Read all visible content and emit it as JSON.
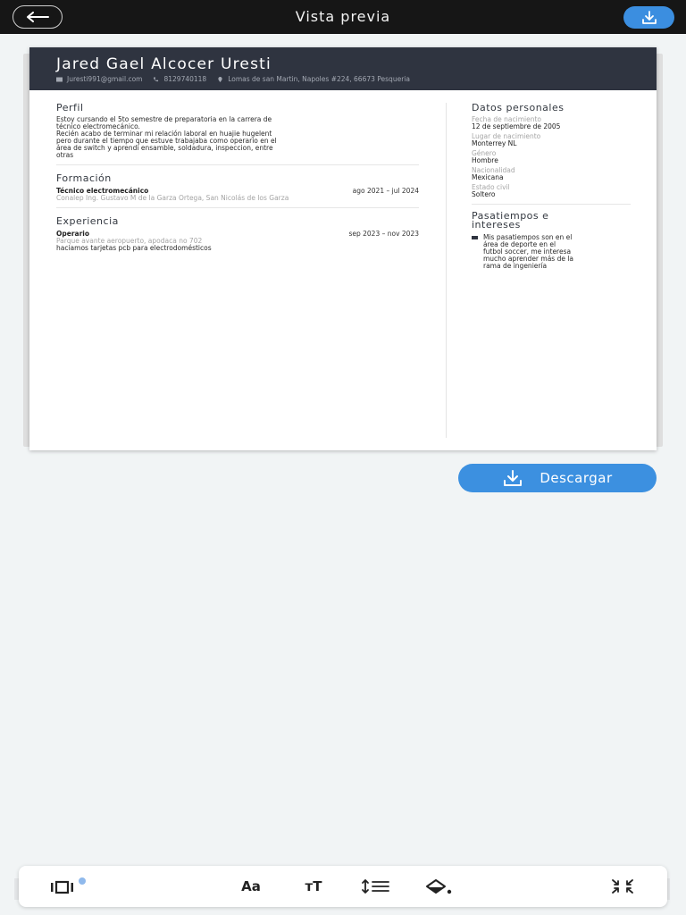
{
  "topbar": {
    "title": "Vista previa"
  },
  "resume": {
    "name": "Jared Gael Alcocer Uresti",
    "contact": {
      "email": "Juresti991@gmail.com",
      "phone": "8129740118",
      "address": "Lomas de san Martin, Napoles #224, 66673 Pesqueria"
    },
    "profile": {
      "title": "Perfil",
      "lines": [
        "Estoy cursando el 5to semestre de preparatoria en la carrera de",
        "técnico electromecánico.",
        "Recién acabo de terminar mi relación laboral en huajie hugelent",
        "pero durante el tiempo que estuve trabajaba como operario en el",
        "área de switch y aprendí ensamble, soldadura, inspeccion, entre",
        "otras"
      ]
    },
    "education": {
      "title": "Formación",
      "degree": "Técnico electromecánico",
      "dates": "ago 2021 – jul 2024",
      "school": "Conalep Ing. Gustavo M de la Garza Ortega, San Nicolás de los Garza"
    },
    "experience": {
      "title": "Experiencia",
      "role": "Operario",
      "dates": "sep 2023 – nov 2023",
      "company": "Parque avante aeropuerto, apodaca no 702",
      "description": "haciamos tarjetas pcb para electrodomésticos"
    },
    "personal": {
      "title": "Datos personales",
      "birth_date_label": "Fecha de nacimiento",
      "birth_date": "12 de septiembre de 2005",
      "birth_place_label": "Lugar de nacimiento",
      "birth_place": "Monterrey NL",
      "gender_label": "Género",
      "gender": "Hombre",
      "nationality_label": "Nacionalidad",
      "nationality": "Mexicana",
      "civil_status_label": "Estado civil",
      "civil_status": "Soltero"
    },
    "hobbies": {
      "title_line1": "Pasatiempos e",
      "title_line2": "intereses",
      "lines": [
        "Mis pasatiempos son en el",
        "área de deporte en el",
        "futbol soccer, me interesa",
        "mucho aprender más de la",
        "rama de ingeniería"
      ]
    }
  },
  "download_button": {
    "label": "Descargar"
  },
  "toolbar": {
    "font_label": "Aa",
    "size_label": "тT"
  },
  "colors": {
    "accent": "#3b8ee0",
    "header_dark": "#2f3440",
    "topbar": "#161616"
  }
}
